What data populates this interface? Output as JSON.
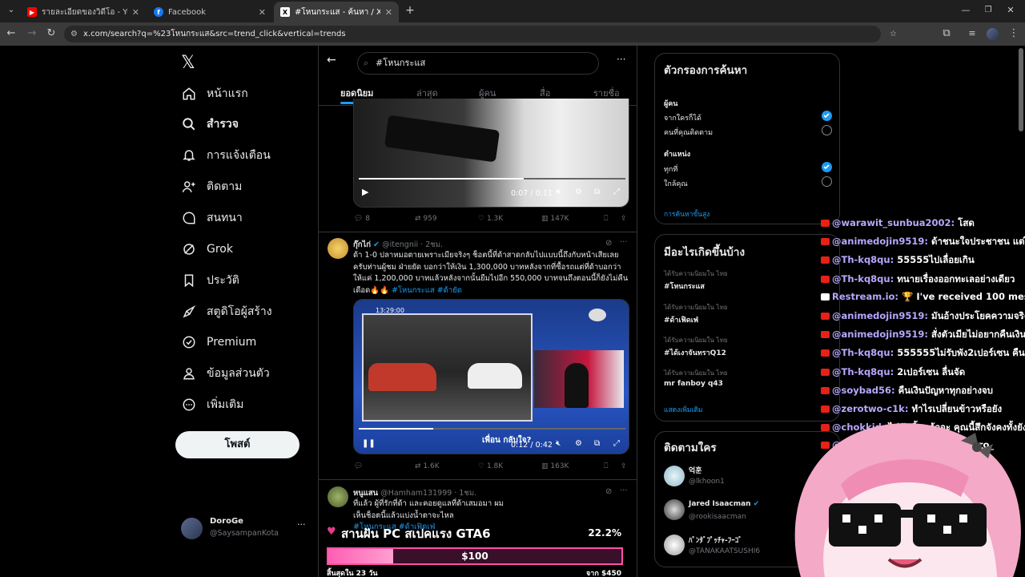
{
  "browser": {
    "tabs": [
      {
        "title": "รายละเอียดของวิดีโอ - YouTube Stu",
        "favicon": "youtube-icon",
        "color": "#ff0000"
      },
      {
        "title": "Facebook",
        "favicon": "facebook-icon",
        "color": "#1877f2"
      },
      {
        "title": "#โหนกระแส - ค้นหา / X",
        "favicon": "x-icon",
        "color": "#000000"
      }
    ],
    "new_tab": "+",
    "url": "x.com/search?q=%23โหนกระแส&src=trend_click&vertical=trends"
  },
  "nav": {
    "items": [
      {
        "label": "หน้าแรก",
        "icon": "home-icon"
      },
      {
        "label": "สำรวจ",
        "icon": "search-icon"
      },
      {
        "label": "การแจ้งเตือน",
        "icon": "bell-icon"
      },
      {
        "label": "ติดตาม",
        "icon": "follow-icon"
      },
      {
        "label": "สนทนา",
        "icon": "chat-icon"
      },
      {
        "label": "Grok",
        "icon": "grok-icon"
      },
      {
        "label": "ประวัติ",
        "icon": "bookmark-icon"
      },
      {
        "label": "สตูดิโอผู้สร้าง",
        "icon": "rocket-icon"
      },
      {
        "label": "Premium",
        "icon": "verified-icon"
      },
      {
        "label": "ข้อมูลส่วนตัว",
        "icon": "person-icon"
      },
      {
        "label": "เพิ่มเติม",
        "icon": "more-icon"
      }
    ],
    "post_label": "โพสต์",
    "profile": {
      "name": "DoroGe",
      "handle": "@SaysampanKota",
      "more": "···"
    }
  },
  "search": {
    "query": "#โหนกระแส",
    "tabs": [
      "ยอดนิยม",
      "ล่าสุด",
      "ผู้คน",
      "สื่อ",
      "รายชื่อ"
    ],
    "more": "···"
  },
  "tweets": [
    {
      "video_time": "0:07 / 0:11",
      "stats": {
        "replies": "8",
        "reposts": "959",
        "likes": "1.3K",
        "views": "147K"
      }
    },
    {
      "name": "กุ๊กไก่",
      "handle": "@itengnii · 2ชม.",
      "text": "ด้า 1-0 ปลาหมอตายเพราะเมียจริงๆ ช็อตนี้ที่ด้าสาดกลับไปแบบนี้ถึงกับหน้าเสียเลย ครับท่านผู้ชม ฝ่ายยัด บอกว่าให้เงิน 1,300,000 บาทหลังจากที่ซื้อรถแต่ที่ด้าบอกว่าให้แค่ 1,200,000 บาทแล้วหลังจากนั้นยืมไปอีก 550,000 บาทจนถึงตอนนี้ก็ยังไม่คืน เดือด🔥🔥",
      "hashtags": "#โหนกระแส #ด้ายัด",
      "video_time": "0:12 / 0:42",
      "timestamp_overlay": "13:29:00",
      "banner": "เพื่อน กลับใจ?",
      "stats": {
        "replies": "",
        "reposts": "1.6K",
        "likes": "1.8K",
        "views": "163K"
      }
    },
    {
      "name": "หนูแสน",
      "handle": "@Hamham131999 · 1ชม.",
      "text": "ที่แล้ว ผู้ที่รักที่ด้า และคอยดูแลที่ด้าเสมอมา ผมเห็นช็อตนี้แล้วแบ่งน้ำตาจะไหล",
      "hashtags": "#โหนกระแส #ด้าเฟิดเฟ่"
    }
  ],
  "filters": {
    "title": "ตัวกรองการค้นหา",
    "people_label": "ผู้คน",
    "people": [
      {
        "label": "จากใครก็ได้",
        "checked": true
      },
      {
        "label": "คนที่คุณติดตาม",
        "checked": false
      }
    ],
    "location_label": "ตำแหน่ง",
    "location": [
      {
        "label": "ทุกที่",
        "checked": true
      },
      {
        "label": "ใกล้คุณ",
        "checked": false
      }
    ],
    "advanced": "การค้นหาขั้นสูง"
  },
  "trends": {
    "title": "มีอะไรเกิดขึ้นบ้าง",
    "items": [
      {
        "meta": "ได้รับความนิยมใน ไทย",
        "name": "#โหนกระแส"
      },
      {
        "meta": "ได้รับความนิยมใน ไทย",
        "name": "#ด้าเฟิดเฟ่"
      },
      {
        "meta": "ได้รับความนิยมใน ไทย",
        "name": "#ได้เงาจันทราQ12"
      },
      {
        "meta": "ได้รับความนิยมใน ไทย",
        "name": "mr fanboy q43"
      }
    ],
    "show_more": "แสดงเพิ่มเติม"
  },
  "who_to_follow": {
    "title": "ติดตามใคร",
    "items": [
      {
        "name": "억훈",
        "handle": "@lkhoon1"
      },
      {
        "name": "Jared Isaacman",
        "handle": "@rookisaacman"
      },
      {
        "name": "ﾊﾟﾝﾀﾞﾌﾟｯﾁｬ-ﾌｰｺﾞ",
        "handle": "@TANAKAATSUSHI6"
      }
    ]
  },
  "chat": [
    {
      "user": "@warawit_sunbua2002:",
      "msg": " โสด"
    },
    {
      "user": "@animedojin9519:",
      "msg": " ด้าชนะใจประชาชน แต่ไนส์"
    },
    {
      "user": "@Th-kq8qu:",
      "msg": " 55555ไปเลื่อยเกิน"
    },
    {
      "user": "@Th-kq8qu:",
      "msg": " ทนายเรื่องออกทะเลอย่างเดียว"
    },
    {
      "user": "Restream.io:",
      "msg": " 🏆 I've received 100 messages"
    },
    {
      "user": "@animedojin9519:",
      "msg": " มันอ้างประโยคความจริงเกิน"
    },
    {
      "user": "@animedojin9519:",
      "msg": " สั่งตัวเมียไม่อยากคืนเงินไง"
    },
    {
      "user": "@Th-kq8qu:",
      "msg": " 555555ไม่รับพัง2เปอร์เซน คืนตัง"
    },
    {
      "user": "@Th-kq8qu:",
      "msg": " 2เปอร์เซน ลื่นจัด"
    },
    {
      "user": "@soybad56:",
      "msg": " คืนเงินปัญหาทุกอย่างจบ"
    },
    {
      "user": "@zerotwo-c1k:",
      "msg": " ทำไรเปลี่ยนข้าวหรือยัง"
    },
    {
      "user": "@chokkid:",
      "msg": " ไม่มันสิ้นแล้วจะ คุณนี้สึกจังคงทั้งยัง"
    },
    {
      "user": "@chokkid:",
      "msg": " _doro_ _doro_ _doro_"
    }
  ],
  "donation": {
    "title": "สานฝัน PC สเปคแรง GTA6",
    "percent_text": "22.2%",
    "progress": 0.222,
    "amount": "$100",
    "left": "สิ้นสุดใน 23 วัน",
    "target": "จาก $450"
  }
}
